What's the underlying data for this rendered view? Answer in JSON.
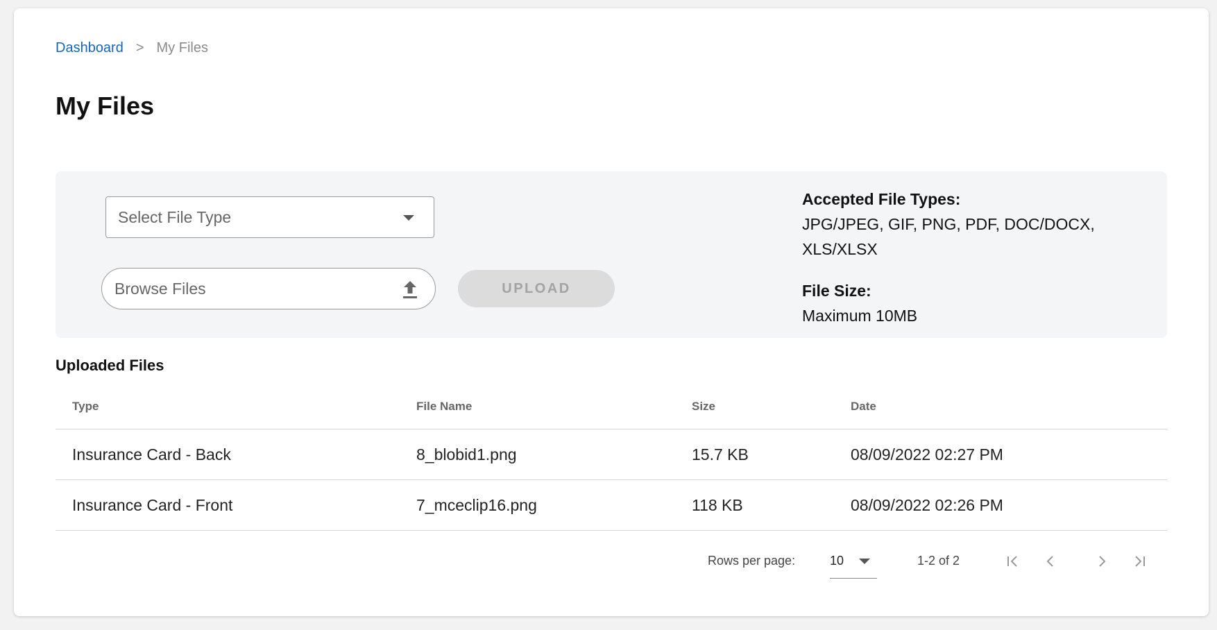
{
  "breadcrumb": {
    "home": "Dashboard",
    "separator": ">",
    "current": "My Files"
  },
  "page_title": "My Files",
  "upload": {
    "file_type_placeholder": "Select File Type",
    "browse_placeholder": "Browse Files",
    "upload_label": "UPLOAD",
    "accepted_heading": "Accepted File Types:",
    "accepted_types": "JPG/JPEG, GIF, PNG, PDF, DOC/DOCX, XLS/XLSX",
    "size_heading": "File Size:",
    "size_value": "Maximum 10MB"
  },
  "uploaded": {
    "title": "Uploaded Files",
    "columns": [
      "Type",
      "File Name",
      "Size",
      "Date"
    ],
    "rows": [
      {
        "type": "Insurance Card - Back",
        "name": "8_blobid1.png",
        "size": "15.7 KB",
        "date": "08/09/2022 02:27 PM"
      },
      {
        "type": "Insurance Card - Front",
        "name": "7_mceclip16.png",
        "size": "118 KB",
        "date": "08/09/2022 02:26 PM"
      }
    ]
  },
  "pagination": {
    "rows_label": "Rows per page:",
    "rows_value": "10",
    "range": "1-2 of 2"
  },
  "colors": {
    "link": "#1565c0",
    "panel_bg": "#f4f5f7",
    "disabled_button": "#dcdcdc"
  },
  "icons": {
    "select_caret": "chevron-down-icon",
    "browse": "upload-icon",
    "first": "first-page-icon",
    "prev": "chevron-left-icon",
    "next": "chevron-right-icon",
    "last": "last-page-icon"
  }
}
